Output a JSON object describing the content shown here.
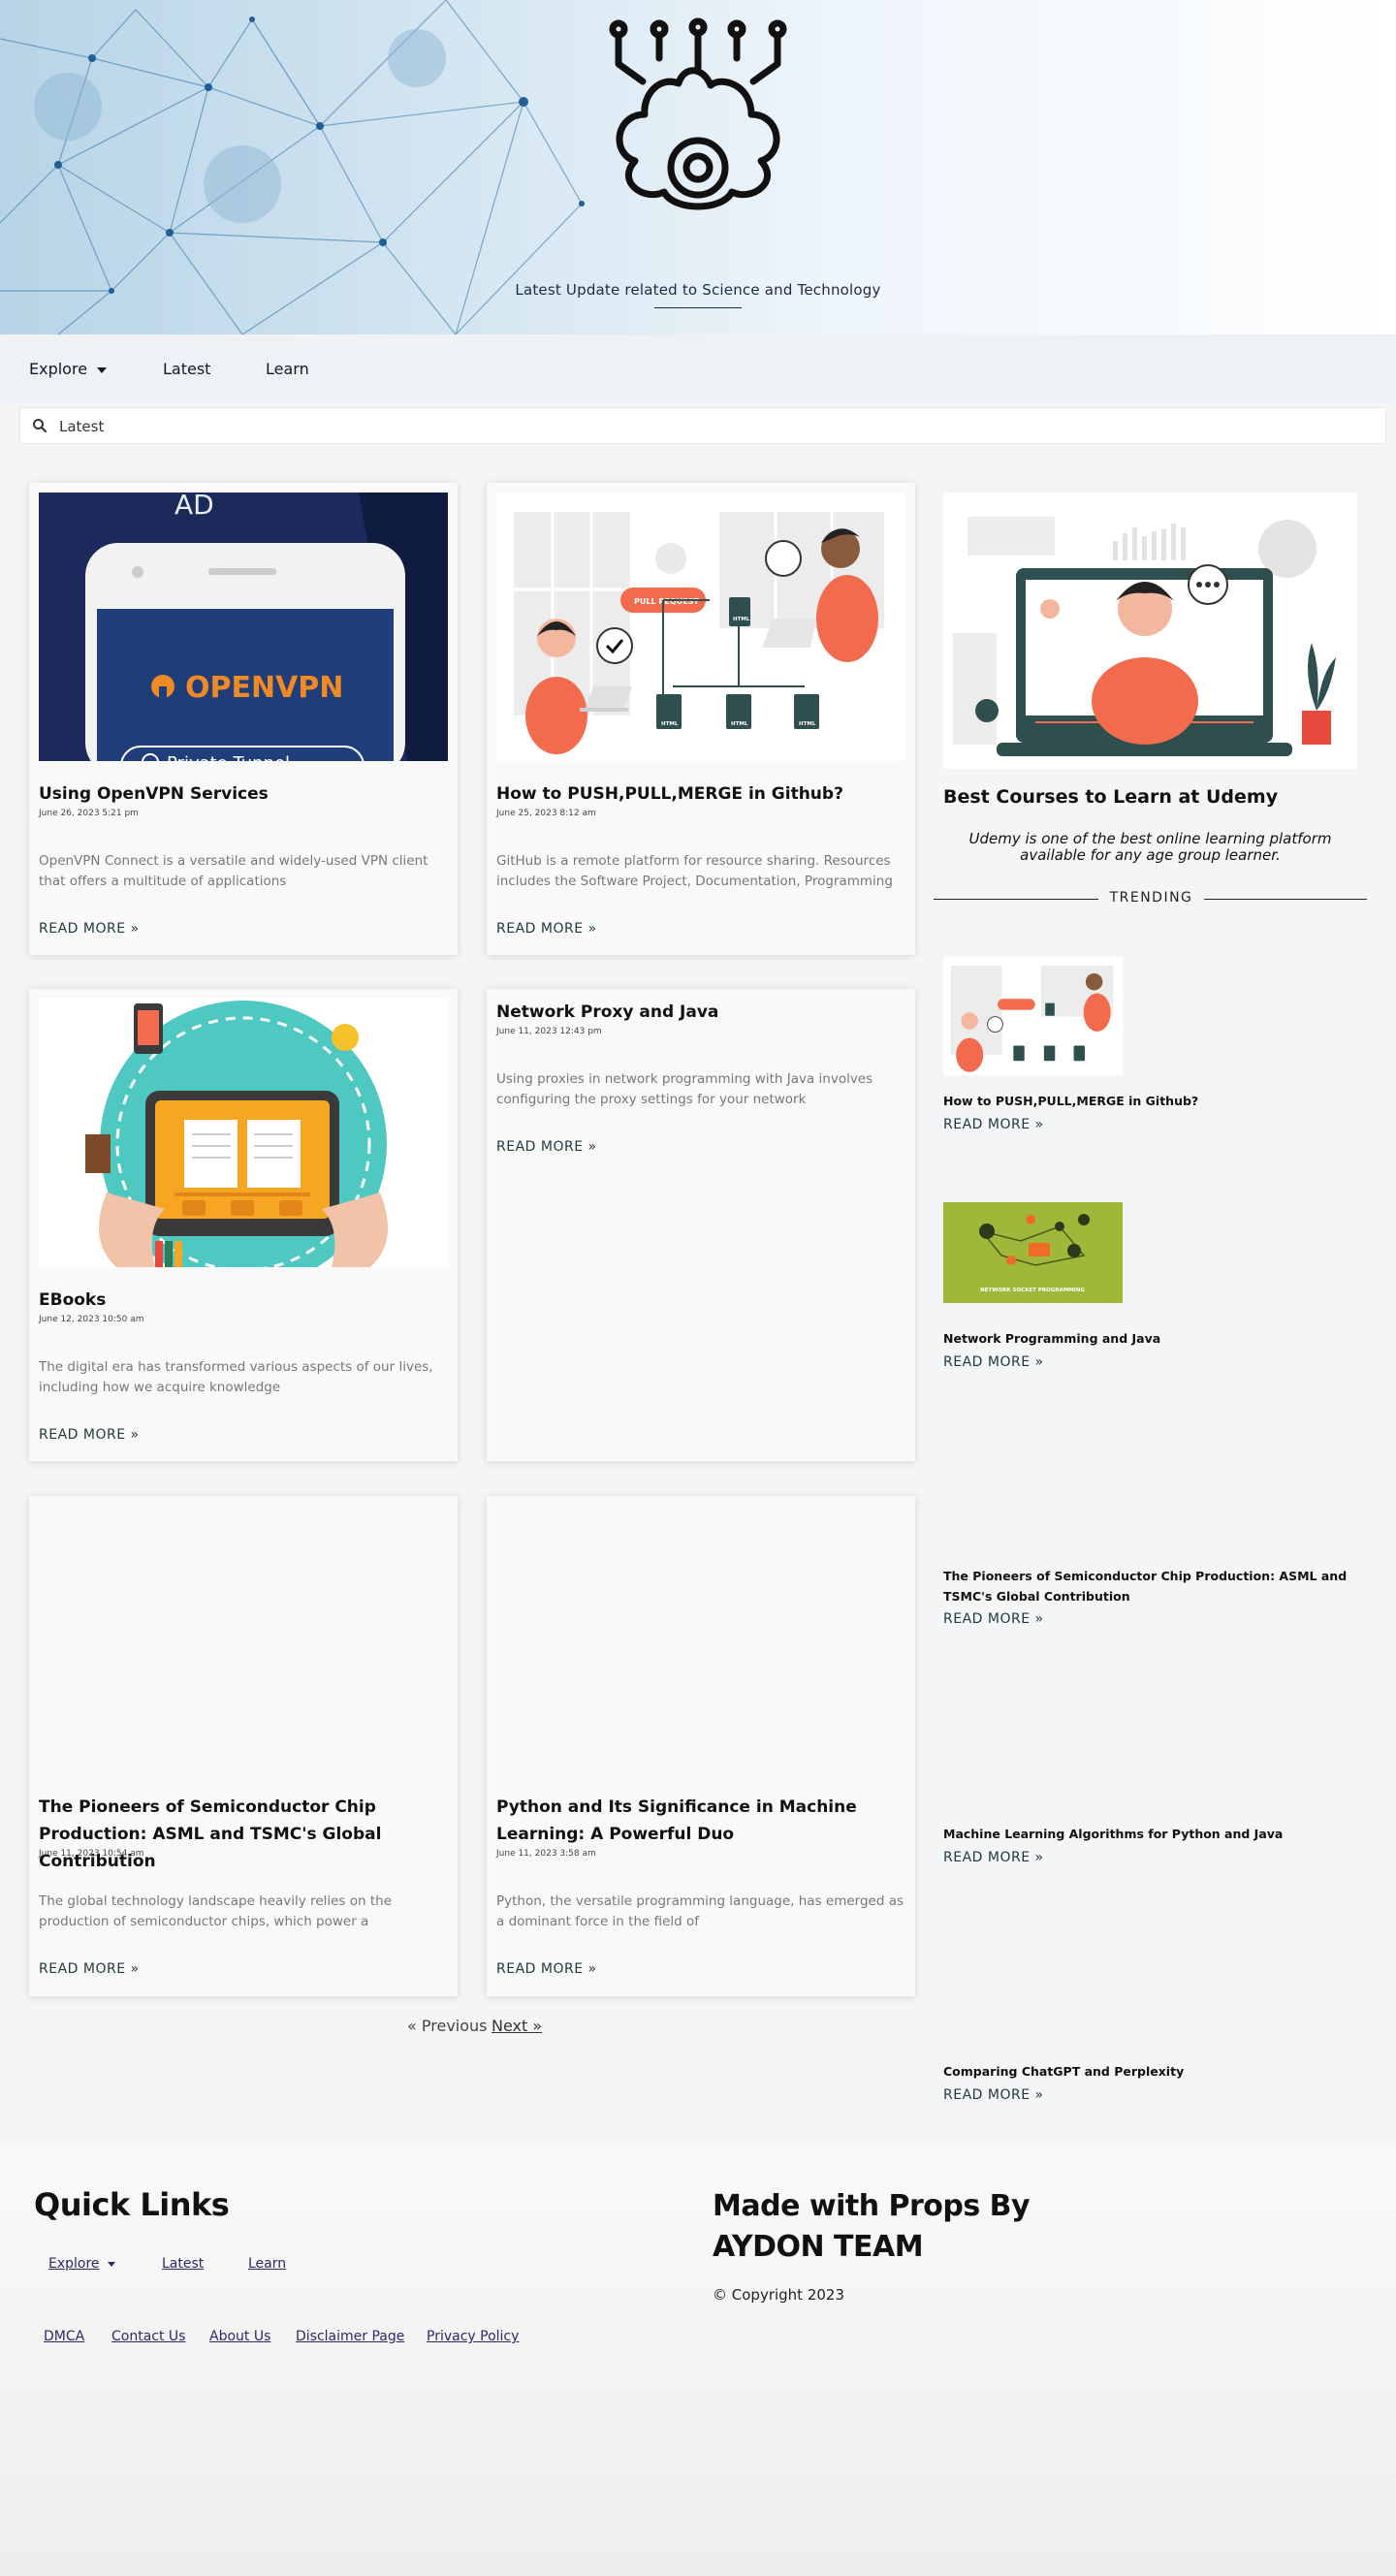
{
  "hero": {
    "tagline": "Latest Update related to Science and Technology"
  },
  "nav": {
    "explore": "Explore",
    "latest": "Latest",
    "learn": "Learn"
  },
  "search": {
    "value": "Latest"
  },
  "posts": [
    {
      "title": "Using OpenVPN Services",
      "date": "June 26, 2023 5:21 pm",
      "excerpt": "OpenVPN Connect is a versatile and widely-used VPN client that offers a multitude of applications",
      "more": "READ MORE »",
      "image": {
        "ad_label": "AD",
        "brand": "OPENVPN",
        "button_text": "Private Tunnel"
      }
    },
    {
      "title": "How to PUSH,PULL,MERGE in Github?",
      "date": "June 25, 2023 8:12 am",
      "excerpt": "GitHub is a remote platform for resource sharing. Resources includes the Software Project, Documentation, Programming",
      "more": "READ MORE »",
      "image": {
        "badge": "PULL REQUEST",
        "file_label": "HTML"
      }
    },
    {
      "title": "EBooks",
      "date": "June 12, 2023 10:50 am",
      "excerpt": "The digital era has transformed various aspects of our lives, including how we acquire knowledge",
      "more": "READ MORE »"
    },
    {
      "title": "Network Proxy and Java",
      "date": "June 11, 2023 12:43 pm",
      "excerpt": "Using proxies in network programming with Java involves configuring the proxy settings for your network",
      "more": "READ MORE »"
    },
    {
      "title": "The Pioneers of Semiconductor Chip Production: ASML and TSMC's Global Contribution",
      "date": "June 11, 2023 10:54 am",
      "excerpt": "The global technology landscape heavily relies on the production of semiconductor chips, which power a",
      "more": "READ MORE »"
    },
    {
      "title": "Python and Its Significance in Machine Learning: A Powerful Duo",
      "date": "June 11, 2023 3:58 am",
      "excerpt": "Python, the versatile programming language, has emerged as a dominant force in the field of",
      "more": "READ MORE »"
    }
  ],
  "pagination": {
    "previous": "« Previous",
    "next": "Next »"
  },
  "sidebar": {
    "feature_title": "Best Courses to Learn at Udemy",
    "feature_desc": "Udemy is one of the best online learning platform available for any age group learner.",
    "trending_label": "TRENDING",
    "trending": [
      {
        "title": "How to PUSH,PULL,MERGE in Github?",
        "more": "READ MORE »"
      },
      {
        "title": "Network Programming and Java",
        "more": "READ MORE »",
        "thumb_caption": "NETWORK SOCKET PROGRAMMING"
      },
      {
        "title": "The Pioneers of Semiconductor Chip Production: ASML and TSMC's Global Contribution",
        "more": "READ MORE »"
      },
      {
        "title": "Machine Learning Algorithms for Python and Java",
        "more": "READ MORE »"
      },
      {
        "title": "Comparing ChatGPT and Perplexity",
        "more": "READ MORE »"
      }
    ]
  },
  "footer": {
    "quick_links_title": "Quick Links",
    "nav": {
      "explore": "Explore",
      "latest": "Latest",
      "learn": "Learn"
    },
    "links": [
      "DMCA",
      "Contact Us",
      "About Us",
      "Disclaimer Page",
      "Privacy Policy"
    ],
    "made_with": "Made with Props By AYDON TEAM",
    "copyright": "© Copyright 2023"
  },
  "colors": {
    "accent": "#1f3a3a",
    "orange": "#f26b4c",
    "navy": "#1e2b5e",
    "teal": "#2f4f4f"
  }
}
